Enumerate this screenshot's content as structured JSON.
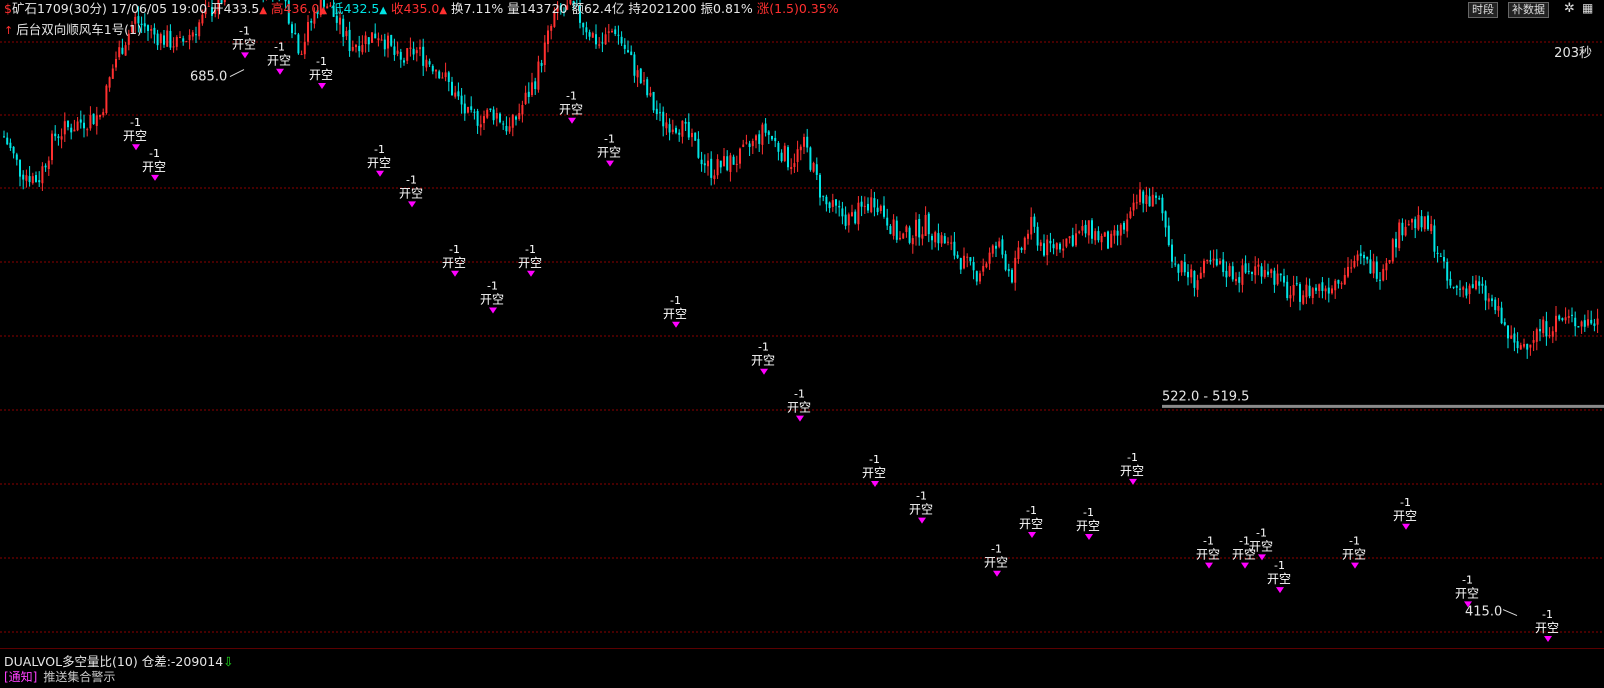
{
  "header": {
    "symbol": "矿石1709",
    "period": "(30分)",
    "datetime": "17/06/05 19:00",
    "open_label": "开",
    "open": "433.5",
    "high_label": "高",
    "high": "436.0",
    "low_label": "低",
    "low": "432.5",
    "close_label": "收",
    "close": "435.0",
    "turnover_label": "换",
    "turnover": "7.11%",
    "volume_label": "量",
    "volume": "143720",
    "amount_label": "额",
    "amount": "62.4亿",
    "oi_label": "持",
    "oi": "2021200",
    "amp_label": "振",
    "amp": "0.81%",
    "change_label": "涨",
    "change": "(1.5)",
    "change_pct": "0.35%"
  },
  "toolbar": {
    "segment_button": "时段",
    "supplement_button": "补数据"
  },
  "strategy_title": "后台双向顺风车1号(1)",
  "countdown": "203秒",
  "indicator": {
    "name": "DUALVOL多空量比(10)",
    "diff_label": "仓差:",
    "diff_value": "-209014",
    "notice_prefix": "[通知]",
    "notice_text": "推送集合警示"
  },
  "colors": {
    "background": "#000000",
    "up": "#ff3030",
    "down": "#00e5e5",
    "grid": "#8b0000",
    "signal": "#ff00ff",
    "label": "#ffffff"
  },
  "chart_data": {
    "type": "candlestick",
    "ylim": [
      405,
      700
    ],
    "price_extremes": [
      {
        "label": "685.0",
        "value": 685.0
      },
      {
        "label": "415.0",
        "value": 415.0
      }
    ],
    "range_label": {
      "text": "522.0 - 519.5",
      "high": 522.0,
      "low": 519.5
    },
    "signal_text": {
      "qty": "-1",
      "action": "开空"
    },
    "signals": [
      {
        "bar": 136,
        "price": 645
      },
      {
        "bar": 155,
        "price": 630
      },
      {
        "bar": 245,
        "price": 690
      },
      {
        "bar": 280,
        "price": 682
      },
      {
        "bar": 322,
        "price": 675
      },
      {
        "bar": 380,
        "price": 632
      },
      {
        "bar": 412,
        "price": 617
      },
      {
        "bar": 455,
        "price": 583
      },
      {
        "bar": 493,
        "price": 565
      },
      {
        "bar": 531,
        "price": 583
      },
      {
        "bar": 572,
        "price": 658
      },
      {
        "bar": 610,
        "price": 637
      },
      {
        "bar": 676,
        "price": 558
      },
      {
        "bar": 764,
        "price": 535
      },
      {
        "bar": 800,
        "price": 512
      },
      {
        "bar": 875,
        "price": 480
      },
      {
        "bar": 922,
        "price": 462
      },
      {
        "bar": 997,
        "price": 436
      },
      {
        "bar": 1032,
        "price": 455
      },
      {
        "bar": 1089,
        "price": 454
      },
      {
        "bar": 1133,
        "price": 481
      },
      {
        "bar": 1209,
        "price": 440
      },
      {
        "bar": 1245,
        "price": 440
      },
      {
        "bar": 1262,
        "price": 444
      },
      {
        "bar": 1280,
        "price": 428
      },
      {
        "bar": 1355,
        "price": 440
      },
      {
        "bar": 1406,
        "price": 459
      },
      {
        "bar": 1468,
        "price": 421
      },
      {
        "bar": 1548,
        "price": 404
      }
    ],
    "trend_knots": [
      [
        0,
        532
      ],
      [
        20,
        490
      ],
      [
        38,
        480
      ],
      [
        55,
        525
      ],
      [
        80,
        538
      ],
      [
        100,
        545
      ],
      [
        115,
        600
      ],
      [
        135,
        640
      ],
      [
        155,
        625
      ],
      [
        180,
        615
      ],
      [
        215,
        655
      ],
      [
        240,
        680
      ],
      [
        265,
        672
      ],
      [
        280,
        675
      ],
      [
        300,
        610
      ],
      [
        322,
        665
      ],
      [
        350,
        615
      ],
      [
        380,
        628
      ],
      [
        400,
        596
      ],
      [
        415,
        610
      ],
      [
        440,
        590
      ],
      [
        470,
        540
      ],
      [
        495,
        548
      ],
      [
        510,
        530
      ],
      [
        535,
        580
      ],
      [
        555,
        645
      ],
      [
        572,
        652
      ],
      [
        600,
        615
      ],
      [
        615,
        632
      ],
      [
        640,
        580
      ],
      [
        660,
        540
      ],
      [
        680,
        535
      ],
      [
        710,
        490
      ],
      [
        740,
        502
      ],
      [
        765,
        530
      ],
      [
        790,
        498
      ],
      [
        805,
        515
      ],
      [
        825,
        455
      ],
      [
        850,
        440
      ],
      [
        875,
        462
      ],
      [
        900,
        420
      ],
      [
        925,
        436
      ],
      [
        950,
        412
      ],
      [
        975,
        385
      ],
      [
        998,
        415
      ],
      [
        1012,
        385
      ],
      [
        1030,
        435
      ],
      [
        1045,
        410
      ],
      [
        1065,
        420
      ],
      [
        1090,
        430
      ],
      [
        1110,
        415
      ],
      [
        1130,
        440
      ],
      [
        1140,
        465
      ],
      [
        1160,
        455
      ],
      [
        1175,
        396
      ],
      [
        1195,
        380
      ],
      [
        1210,
        395
      ],
      [
        1240,
        385
      ],
      [
        1265,
        395
      ],
      [
        1290,
        365
      ],
      [
        1330,
        375
      ],
      [
        1355,
        400
      ],
      [
        1380,
        390
      ],
      [
        1405,
        440
      ],
      [
        1430,
        432
      ],
      [
        1450,
        370
      ],
      [
        1475,
        375
      ],
      [
        1495,
        352
      ],
      [
        1515,
        310
      ],
      [
        1540,
        330
      ],
      [
        1560,
        340
      ],
      [
        1600,
        338
      ]
    ]
  }
}
